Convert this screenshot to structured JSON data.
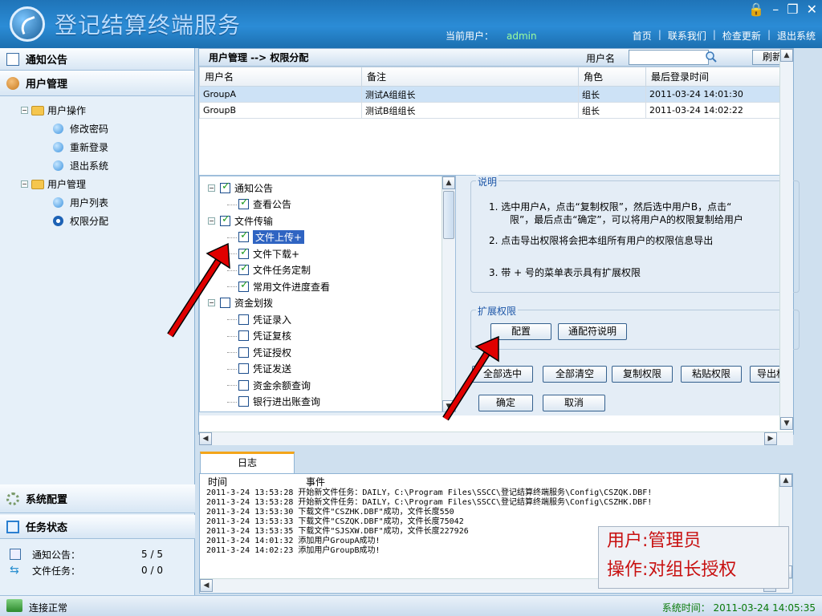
{
  "app": {
    "title": "登记结算终端服务",
    "current_user_label": "当前用户：",
    "current_user": "admin",
    "nav": [
      "首页",
      "联系我们",
      "检查更新",
      "退出系统"
    ]
  },
  "sidebar": {
    "notice": "通知公告",
    "user_mgmt": "用户管理",
    "tree": {
      "user_ops": "用户操作",
      "change_pwd": "修改密码",
      "relogin": "重新登录",
      "exit": "退出系统",
      "user_mgmt": "用户管理",
      "user_list": "用户列表",
      "perm_assign": "权限分配"
    },
    "system_config": "系统配置",
    "task_status": "任务状态",
    "tasks": [
      {
        "label": "通知公告：",
        "value": "5 / 5"
      },
      {
        "label": "文件任务：",
        "value": "0 / 0"
      }
    ]
  },
  "main": {
    "breadcrumb": "用户管理 --> 权限分配",
    "search_label": "用户名",
    "search_value": "",
    "refresh": "刷新",
    "columns": [
      "用户名",
      "备注",
      "角色",
      "最后登录时间"
    ],
    "rows": [
      [
        "GroupA",
        "测试A组组长",
        "组长",
        "2011-03-24 14:01:30"
      ],
      [
        "GroupB",
        "测试B组组长",
        "组长",
        "2011-03-24 14:02:22"
      ]
    ],
    "perm_tree": [
      {
        "label": "通知公告",
        "checked": true,
        "level": 0
      },
      {
        "label": "查看公告",
        "checked": true,
        "level": 1
      },
      {
        "label": "文件传输",
        "checked": true,
        "level": 0
      },
      {
        "label": "文件上传+",
        "checked": true,
        "level": 1
      },
      {
        "label": "文件下载+",
        "checked": true,
        "level": 1
      },
      {
        "label": "文件任务定制",
        "checked": true,
        "level": 1
      },
      {
        "label": "常用文件进度查看",
        "checked": true,
        "level": 1
      },
      {
        "label": "资金划拨",
        "checked": false,
        "level": 0
      },
      {
        "label": "凭证录入",
        "checked": false,
        "level": 1
      },
      {
        "label": "凭证复核",
        "checked": false,
        "level": 1
      },
      {
        "label": "凭证授权",
        "checked": false,
        "level": 1
      },
      {
        "label": "凭证发送",
        "checked": false,
        "level": 1
      },
      {
        "label": "资金余额查询",
        "checked": false,
        "level": 1
      },
      {
        "label": "银行进出账查询",
        "checked": false,
        "level": 1
      }
    ],
    "notes_title": "说明",
    "notes": [
      "1.  选中用户A，点击“复制权限”，然后选中用户B，点击“",
      "限”，最后点击“确定”，可以将用户A的权限复制给用户",
      "2.  点击导出权限将会把本组所有用户的权限信息导出",
      "3.  带 + 号的菜单表示具有扩展权限"
    ],
    "ext_title": "扩展权限",
    "buttons": {
      "config": "配置",
      "wildcard": "通配符说明",
      "select_all": "全部选中",
      "clear_all": "全部清空",
      "copy": "复制权限",
      "paste": "粘贴权限",
      "export": "导出权",
      "ok": "确定",
      "cancel": "取消"
    }
  },
  "log": {
    "tab": "日志",
    "col_time": "时间",
    "col_event": "事件",
    "lines": [
      "2011-3-24 13:53:28 开始新文件任务：DAILY，C:\\Program Files\\SSCC\\登记结算终端服务\\Config\\CSZQK.DBF!",
      "2011-3-24 13:53:28 开始新文件任务：DAILY，C:\\Program Files\\SSCC\\登记结算终端服务\\Config\\CSZHK.DBF!",
      "2011-3-24 13:53:30 下载文件\"CSZHK.DBF\"成功，文件长度550",
      "2011-3-24 13:53:33 下载文件\"CSZQK.DBF\"成功，文件长度75042",
      "2011-3-24 13:53:35 下载文件\"SJSXW.DBF\"成功，文件长度227926",
      "2011-3-24 14:01:32 添加用户GroupA成功!",
      "2011-3-24 14:02:23 添加用户GroupB成功!"
    ],
    "overlay_line1": "用户:管理员",
    "overlay_line2": "操作:对组长授权"
  },
  "status": {
    "left": "连接正常",
    "right": "系统时间： 2011-03-24 14:05:35"
  }
}
